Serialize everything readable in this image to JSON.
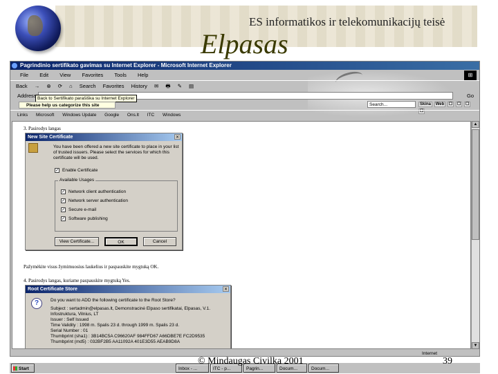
{
  "slide": {
    "course_title": "ES informatikos ir telekomunikacijų teisė",
    "title": "Elpasas",
    "footer": "© Mindaugas Civilka 2001",
    "page_number": "39"
  },
  "browser": {
    "window_title": "Pagrindinio sertifikato gavimas su Internet Explorer - Microsoft Internet Explorer",
    "menu": [
      "File",
      "Edit",
      "View",
      "Favorites",
      "Tools",
      "Help"
    ],
    "toolbar": [
      "Back",
      "→",
      "⊗",
      "⟳",
      "⌂",
      "Search",
      "Favorites",
      "History",
      "✉",
      "🖶",
      "✎",
      "▤"
    ],
    "address_label": "Address",
    "go_label": "Go",
    "tooltip": "Back to Sertifikato parašiška su Internet Explorer",
    "help_bar": "Please help us categorize this site",
    "search_placeholder": "Search...",
    "search_buttons": [
      "Skina",
      "Web",
      "☐",
      "☐",
      "☐",
      "☐"
    ],
    "links": [
      "Links",
      "Microsoft",
      "Windows Update",
      "Google",
      "Ons.lt",
      "ITC",
      "Windows"
    ],
    "zone": "Internet"
  },
  "document": {
    "step3": "3. Pasirodys langas",
    "step3_note": "Pažymėkite visus žymimuosius laukelius ir paspauskite mygtuką OK.",
    "step4": "4. Pasirodys langas, kuriame paspauskite mygtuką Yes."
  },
  "site_cert_dialog": {
    "title": "New Site Certificate",
    "message": "You have been offered a new site certificate to place in your list of trusted issuers. Please select the services for which this certificate will be used.",
    "enable": "Enable Certificate",
    "usages_label": "Available Usages",
    "usages": [
      "Network client authentication",
      "Network server authentication",
      "Secure e-mail",
      "Software publishing"
    ],
    "view_button": "View Certificate...",
    "ok_button": "OK",
    "cancel_button": "Cancel"
  },
  "root_store_dialog": {
    "title": "Root Certificate Store",
    "question": "Do you want to ADD the following certificate to the Root Store?",
    "details": [
      "Subject : sertadmin@elpasas.lt, Demonstracinė Elpaso sertifikatai, Elpasas, V.1.",
      "Infostruktura, Vilnius, LT",
      "Issuer : Self Issued",
      "Time Validity : 1998 m. Spalis 23 d. through 1999 m. Spalis 23 d.",
      "Serial Number : 01",
      "Thumbprint (sha1) : 3B14BC5A C96620AF 984FFD67 A66DBE7E FC2D9535",
      "Thumbprint (md5) : 032BF2B5 AA11092A 401E3D55 AEAB9D8A"
    ]
  },
  "taskbar": {
    "start": "Start",
    "tasks": [
      "Inbox - ...",
      "ITC - p...",
      "Pagrin...",
      "Docum...",
      "Docum..."
    ]
  }
}
